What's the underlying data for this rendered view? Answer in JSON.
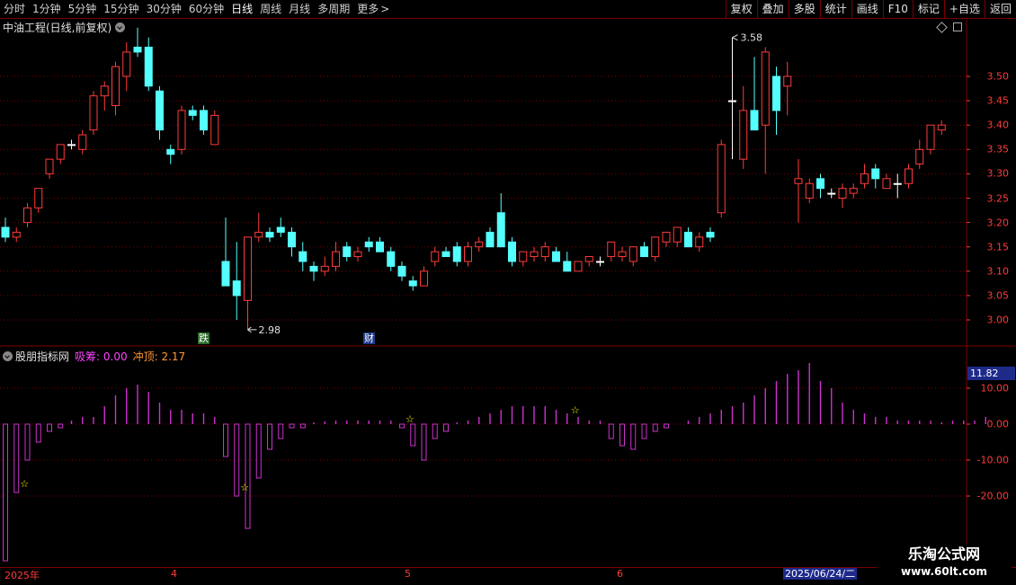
{
  "toolbar": {
    "periods": [
      "分时",
      "1分钟",
      "5分钟",
      "15分钟",
      "30分钟",
      "60分钟",
      "日线",
      "周线",
      "月线",
      "多周期",
      "更多"
    ],
    "active_period": "日线",
    "right_buttons": [
      "复权",
      "叠加",
      "多股",
      "统计",
      "画线",
      "F10",
      "标记",
      "+自选",
      "返回"
    ]
  },
  "main": {
    "title": "中油工程(日线,前复权)",
    "high_label": "3.58",
    "low_label": "2.98",
    "tag_die": "跌",
    "tag_cai": "财",
    "y_ticks": [
      "3.50",
      "3.45",
      "3.40",
      "3.35",
      "3.30",
      "3.25",
      "3.20",
      "3.15",
      "3.10",
      "3.05",
      "3.00"
    ]
  },
  "indicator": {
    "name": "股朋指标网",
    "xc_label": "吸筹: 0.00",
    "cd_label": "冲顶: 2.17",
    "current_value": "11.82",
    "y_ticks": [
      "10.00",
      "0.00",
      "-10.00",
      "-20.00"
    ]
  },
  "dates": {
    "year": "2025年",
    "months": [
      "4",
      "5",
      "6"
    ],
    "cursor_date": "2025/06/24/二"
  },
  "logo": {
    "line1": "乐淘公式网",
    "line2": "www.60lt.com"
  },
  "colors": {
    "up": "#ff3b3b",
    "down": "#54ffff",
    "ind_bar": "#cc33cc",
    "grid": "#7a0000",
    "star": "#ffff00"
  },
  "chart_data": {
    "type": "candlestick",
    "price_ylim": [
      2.95,
      3.6
    ],
    "indicator_ylim": [
      -25,
      15
    ],
    "candles": [
      [
        3.19,
        3.21,
        3.16,
        3.17
      ],
      [
        3.17,
        3.19,
        3.16,
        3.18
      ],
      [
        3.2,
        3.24,
        3.19,
        3.23
      ],
      [
        3.23,
        3.27,
        3.22,
        3.27
      ],
      [
        3.3,
        3.33,
        3.29,
        3.33
      ],
      [
        3.33,
        3.36,
        3.32,
        3.36
      ],
      [
        3.36,
        3.37,
        3.35,
        3.36
      ],
      [
        3.35,
        3.39,
        3.34,
        3.38
      ],
      [
        3.39,
        3.47,
        3.38,
        3.46
      ],
      [
        3.46,
        3.49,
        3.43,
        3.48
      ],
      [
        3.44,
        3.53,
        3.42,
        3.52
      ],
      [
        3.5,
        3.57,
        3.47,
        3.55
      ],
      [
        3.56,
        3.6,
        3.54,
        3.55
      ],
      [
        3.56,
        3.58,
        3.47,
        3.48
      ],
      [
        3.47,
        3.48,
        3.37,
        3.39
      ],
      [
        3.35,
        3.36,
        3.32,
        3.34
      ],
      [
        3.35,
        3.44,
        3.34,
        3.43
      ],
      [
        3.43,
        3.44,
        3.41,
        3.42
      ],
      [
        3.43,
        3.44,
        3.38,
        3.39
      ],
      [
        3.36,
        3.43,
        3.36,
        3.42
      ],
      [
        3.12,
        3.21,
        3.08,
        3.07
      ],
      [
        3.08,
        3.16,
        3.0,
        3.05
      ],
      [
        3.04,
        3.17,
        2.98,
        3.17
      ],
      [
        3.17,
        3.22,
        3.16,
        3.18
      ],
      [
        3.18,
        3.19,
        3.16,
        3.17
      ],
      [
        3.19,
        3.21,
        3.17,
        3.18
      ],
      [
        3.18,
        3.19,
        3.13,
        3.15
      ],
      [
        3.14,
        3.16,
        3.1,
        3.12
      ],
      [
        3.11,
        3.12,
        3.08,
        3.1
      ],
      [
        3.1,
        3.13,
        3.09,
        3.11
      ],
      [
        3.11,
        3.16,
        3.1,
        3.14
      ],
      [
        3.15,
        3.16,
        3.12,
        3.13
      ],
      [
        3.13,
        3.15,
        3.12,
        3.14
      ],
      [
        3.16,
        3.17,
        3.14,
        3.15
      ],
      [
        3.16,
        3.17,
        3.14,
        3.14
      ],
      [
        3.14,
        3.15,
        3.1,
        3.11
      ],
      [
        3.11,
        3.12,
        3.08,
        3.09
      ],
      [
        3.08,
        3.09,
        3.06,
        3.07
      ],
      [
        3.07,
        3.11,
        3.07,
        3.1
      ],
      [
        3.12,
        3.15,
        3.11,
        3.14
      ],
      [
        3.14,
        3.15,
        3.13,
        3.13
      ],
      [
        3.15,
        3.16,
        3.11,
        3.12
      ],
      [
        3.12,
        3.16,
        3.11,
        3.15
      ],
      [
        3.15,
        3.17,
        3.14,
        3.16
      ],
      [
        3.18,
        3.19,
        3.15,
        3.15
      ],
      [
        3.22,
        3.26,
        3.15,
        3.15
      ],
      [
        3.16,
        3.17,
        3.11,
        3.12
      ],
      [
        3.12,
        3.14,
        3.11,
        3.14
      ],
      [
        3.13,
        3.15,
        3.12,
        3.14
      ],
      [
        3.13,
        3.16,
        3.12,
        3.15
      ],
      [
        3.14,
        3.15,
        3.12,
        3.12
      ],
      [
        3.12,
        3.14,
        3.1,
        3.1
      ],
      [
        3.1,
        3.12,
        3.1,
        3.12
      ],
      [
        3.12,
        3.13,
        3.11,
        3.13
      ],
      [
        3.12,
        3.13,
        3.11,
        3.12
      ],
      [
        3.13,
        3.16,
        3.12,
        3.16
      ],
      [
        3.13,
        3.15,
        3.12,
        3.14
      ],
      [
        3.12,
        3.15,
        3.11,
        3.15
      ],
      [
        3.15,
        3.16,
        3.13,
        3.13
      ],
      [
        3.13,
        3.17,
        3.12,
        3.17
      ],
      [
        3.16,
        3.18,
        3.15,
        3.18
      ],
      [
        3.16,
        3.19,
        3.15,
        3.19
      ],
      [
        3.18,
        3.19,
        3.15,
        3.15
      ],
      [
        3.15,
        3.18,
        3.14,
        3.17
      ],
      [
        3.18,
        3.19,
        3.16,
        3.17
      ],
      [
        3.22,
        3.37,
        3.21,
        3.36
      ],
      [
        3.45,
        3.58,
        3.33,
        3.45
      ],
      [
        3.33,
        3.48,
        3.31,
        3.43
      ],
      [
        3.43,
        3.54,
        3.4,
        3.39
      ],
      [
        3.4,
        3.56,
        3.3,
        3.55
      ],
      [
        3.5,
        3.52,
        3.38,
        3.43
      ],
      [
        3.48,
        3.53,
        3.42,
        3.5
      ],
      [
        3.28,
        3.33,
        3.2,
        3.29
      ],
      [
        3.25,
        3.29,
        3.24,
        3.28
      ],
      [
        3.29,
        3.3,
        3.25,
        3.27
      ],
      [
        3.26,
        3.27,
        3.25,
        3.26
      ],
      [
        3.25,
        3.28,
        3.23,
        3.27
      ],
      [
        3.26,
        3.28,
        3.25,
        3.27
      ],
      [
        3.28,
        3.32,
        3.27,
        3.3
      ],
      [
        3.31,
        3.32,
        3.27,
        3.29
      ],
      [
        3.27,
        3.3,
        3.27,
        3.29
      ],
      [
        3.28,
        3.3,
        3.25,
        3.28
      ],
      [
        3.28,
        3.32,
        3.27,
        3.31
      ],
      [
        3.32,
        3.37,
        3.31,
        3.35
      ],
      [
        3.35,
        3.4,
        3.34,
        3.4
      ],
      [
        3.39,
        3.41,
        3.38,
        3.4
      ]
    ],
    "indicator_values": [
      -38,
      -19,
      -10,
      -5,
      -2,
      -1,
      1,
      2,
      2,
      5,
      8,
      10,
      11,
      9,
      6,
      4,
      4,
      3,
      3,
      2,
      -9,
      -20,
      -29,
      -15,
      -7,
      -4,
      -1,
      -1,
      0.5,
      0.8,
      1,
      1,
      1,
      1,
      1,
      1,
      -1,
      -6,
      -10,
      -4,
      -2,
      0.5,
      1,
      2,
      3,
      4,
      5,
      5,
      5,
      5,
      4,
      3,
      2,
      1,
      1,
      -4,
      -6,
      -7,
      -4,
      -2,
      -1,
      0,
      1,
      2,
      3,
      4,
      5,
      6,
      8,
      10,
      12,
      14,
      15,
      17,
      12,
      10,
      6,
      4,
      3,
      2,
      2,
      1,
      1,
      1,
      1,
      0.5,
      1,
      1,
      1,
      2
    ],
    "stars": [
      1,
      21,
      36,
      51
    ]
  }
}
